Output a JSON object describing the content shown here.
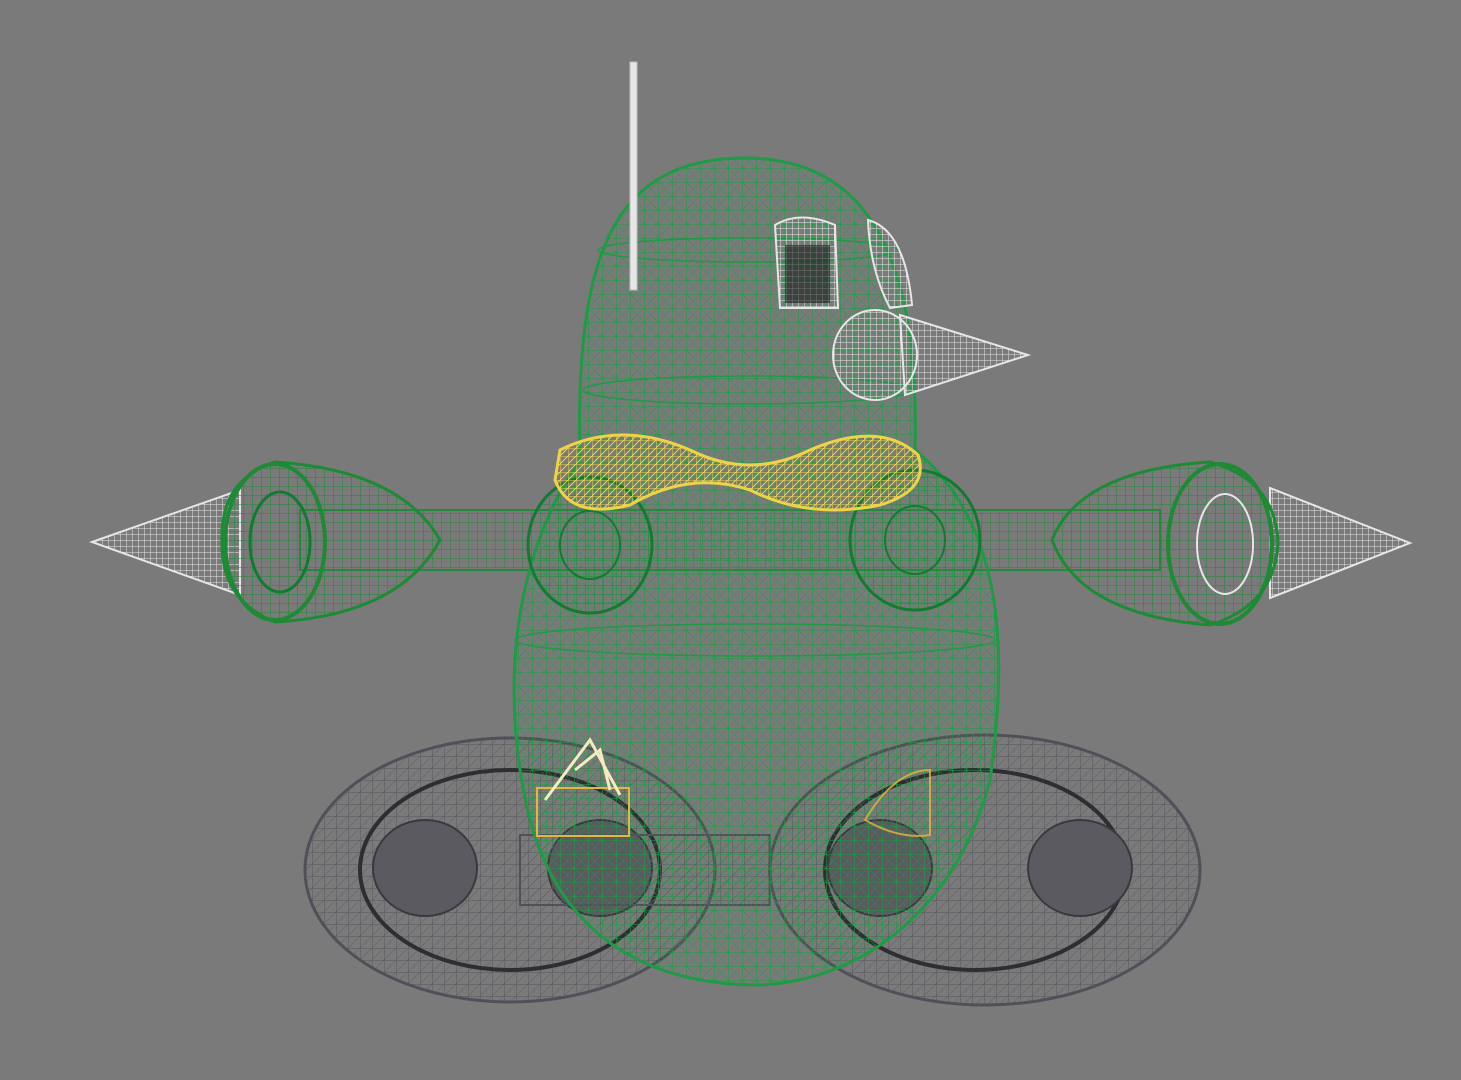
{
  "viewport": {
    "background": "#7a7a7a",
    "render_mode": "wireframe"
  },
  "colors": {
    "body": "#1f9a45",
    "body_dark": "#137a32",
    "engine": "#1e8a36",
    "collar": "#f0d24a",
    "treads": "#4a4a4e",
    "treads_light": "#6a6a70",
    "white_parts": "#e6e6e6",
    "gizmo": "#e2b640",
    "gizmo_light": "#f2ecc0"
  },
  "objects": [
    {
      "name": "robot-body",
      "color": "body"
    },
    {
      "name": "antenna",
      "color": "white_parts"
    },
    {
      "name": "left-eye",
      "color": "white_parts"
    },
    {
      "name": "right-eye",
      "color": "white_parts"
    },
    {
      "name": "nose-cone",
      "color": "white_parts"
    },
    {
      "name": "collar-torus",
      "color": "collar"
    },
    {
      "name": "left-engine",
      "color": "engine"
    },
    {
      "name": "right-engine",
      "color": "engine"
    },
    {
      "name": "left-tread",
      "color": "treads"
    },
    {
      "name": "right-tread",
      "color": "treads"
    },
    {
      "name": "light-gizmo",
      "color": "gizmo"
    }
  ]
}
